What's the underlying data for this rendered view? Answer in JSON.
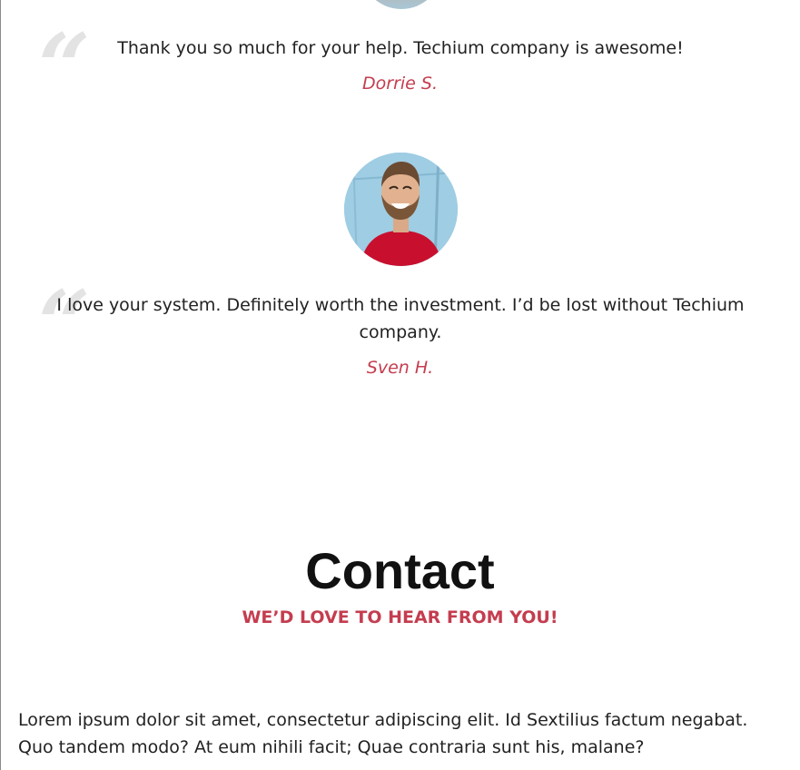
{
  "testimonials": [
    {
      "text": "Thank you so much for your help. Techium company is awesome!",
      "author": "Dorrie S."
    },
    {
      "text": "I love your system. Definitely worth the investment. I’d be lost without Techium company.",
      "author": "Sven H."
    }
  ],
  "quote_glyph": "“",
  "contact": {
    "title": "Contact",
    "subtitle": "WE’D LOVE TO HEAR FROM YOU!",
    "paragraph": "Lorem ipsum dolor sit amet, consectetur adipiscing elit. Id Sextilius factum negabat. Quo tandem modo? At eum nihili facit; Quae contraria sunt his, malane?"
  },
  "colors": {
    "accent": "#c43d4f",
    "text": "#222222",
    "heading": "#111111",
    "quote_mark": "#e3e3e3"
  }
}
